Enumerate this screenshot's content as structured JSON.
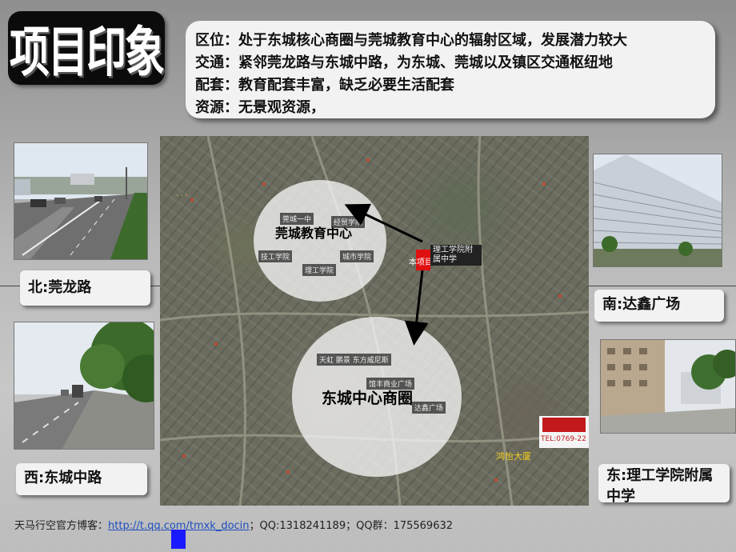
{
  "title": "项目印象",
  "info": {
    "line1": "区位：处于东城核心商圈与莞城教育中心的辐射区域，发展潜力较大",
    "line2": "交通：紧邻莞龙路与东城中路，为东城、莞城以及镇区交通枢纽地",
    "line3": "配套：教育配套丰富，缺乏必要生活配套",
    "line4": "资源：无景观资源，"
  },
  "labels": {
    "north": "北:莞龙路",
    "west": "西:东城中路",
    "south": "南:达鑫广场",
    "east": "东:理工学院附属中学"
  },
  "map": {
    "education_center": "莞城教育中心",
    "business_center": "东城中心商圈",
    "project": "本项目",
    "tag_ligong_affiliated": "理工学院附属中学",
    "tag_ligong": "理工学院",
    "tag_city_college": "城市学院",
    "tag_tech": "技工学院",
    "tag_guancheng_no1": "莞城一中",
    "tag_trade": "经贸学院",
    "tag_tianhong": "天虹 鹏景 东方威尼斯",
    "tag_shopping": "馆丰商业广场",
    "tag_dasin": "达鑫广场",
    "tag_hongyi": "鸿怡大厦",
    "ad_phone": "TEL:0769-22"
  },
  "footer": {
    "prefix": "天马行空官方博客：",
    "link": "http://t.qq.com/tmxk_docin",
    "suffix": "；QQ:1318241189；QQ群：175569632"
  },
  "colors": {
    "project_marker": "#e01010",
    "link": "#1d4fbf",
    "blue_square": "#1a1aff"
  }
}
